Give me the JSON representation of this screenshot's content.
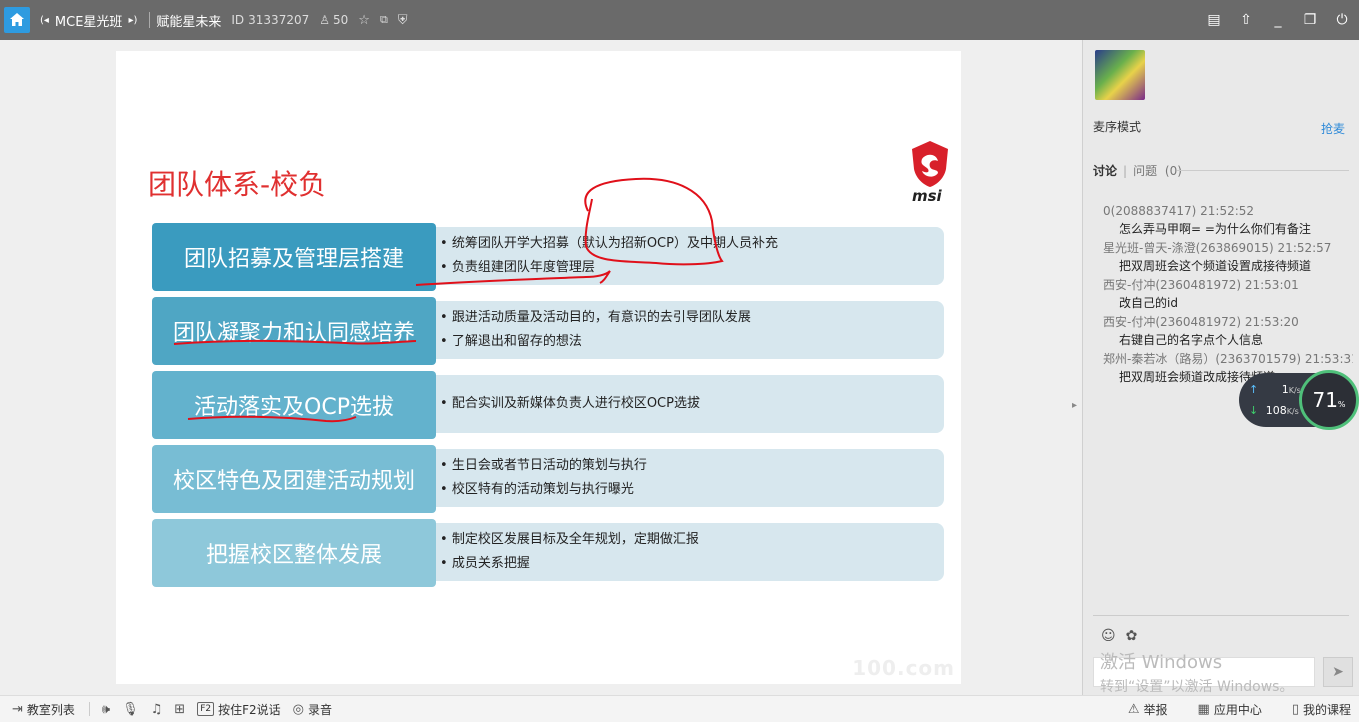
{
  "titlebar": {
    "class_name": "MCE星光班",
    "channel_name": "赋能星未来",
    "id_label": "ID",
    "id_value": "31337207",
    "user_count": "50"
  },
  "slide": {
    "title": "团队体系-校负",
    "logo_text": "msi",
    "watermark": "100.com",
    "rows": [
      {
        "label": "团队招募及管理层搭建",
        "color": "#3a9bbf",
        "items": [
          "统筹团队开学大招募（默认为招新OCP）及中期人员补充",
          "负责组建团队年度管理层"
        ]
      },
      {
        "label": "团队凝聚力和认同感培养",
        "color": "#4fa6c4",
        "items": [
          "跟进活动质量及活动目的，有意识的去引导团队发展",
          "了解退出和留存的想法"
        ]
      },
      {
        "label": "活动落实及OCP选拔",
        "color": "#63b2cd",
        "items": [
          "配合实训及新媒体负责人进行校区OCP选拔"
        ]
      },
      {
        "label": "校区特色及团建活动规划",
        "color": "#78bdd4",
        "items": [
          "生日会或者节日活动的策划与执行",
          "校区特有的活动策划与执行曝光"
        ]
      },
      {
        "label": "把握校区整体发展",
        "color": "#8ec8da",
        "items": [
          "制定校区发展目标及全年规划，定期做汇报",
          "成员关系把握"
        ]
      }
    ]
  },
  "panel": {
    "mode": "麦序模式",
    "grab": "抢麦",
    "tab_discuss": "讨论",
    "tab_question": "问题",
    "question_count": "(0)",
    "messages": [
      {
        "meta": "0(2088837417) 21:52:52",
        "text": "怎么弄马甲啊= =为什么你们有备注"
      },
      {
        "meta": "星光班-曾天-涤澄(263869015) 21:52:57",
        "text": "把双周班会这个频道设置成接待频道"
      },
      {
        "meta": "西安-付冲(2360481972) 21:53:01",
        "text": "改自己的id"
      },
      {
        "meta": "西安-付冲(2360481972) 21:53:20",
        "text": "右键自己的名字点个人信息"
      },
      {
        "meta": "郑州-秦若冰（路易）(2363701579) 21:53:31",
        "text": "把双周班会频道改成接待频道"
      }
    ],
    "upload_speed": "1",
    "download_speed": "108",
    "speed_unit": "K/s",
    "gauge_value": "71",
    "gauge_unit": "%",
    "activate_title": "激活 Windows",
    "activate_sub": "转到“设置”以激活 Windows。"
  },
  "bottombar": {
    "classroom_list": "教室列表",
    "f2_key": "F2",
    "push_to_talk": "按住F2说话",
    "record": "录音",
    "report": "举报",
    "app_center": "应用中心",
    "my_courses": "我的课程"
  }
}
